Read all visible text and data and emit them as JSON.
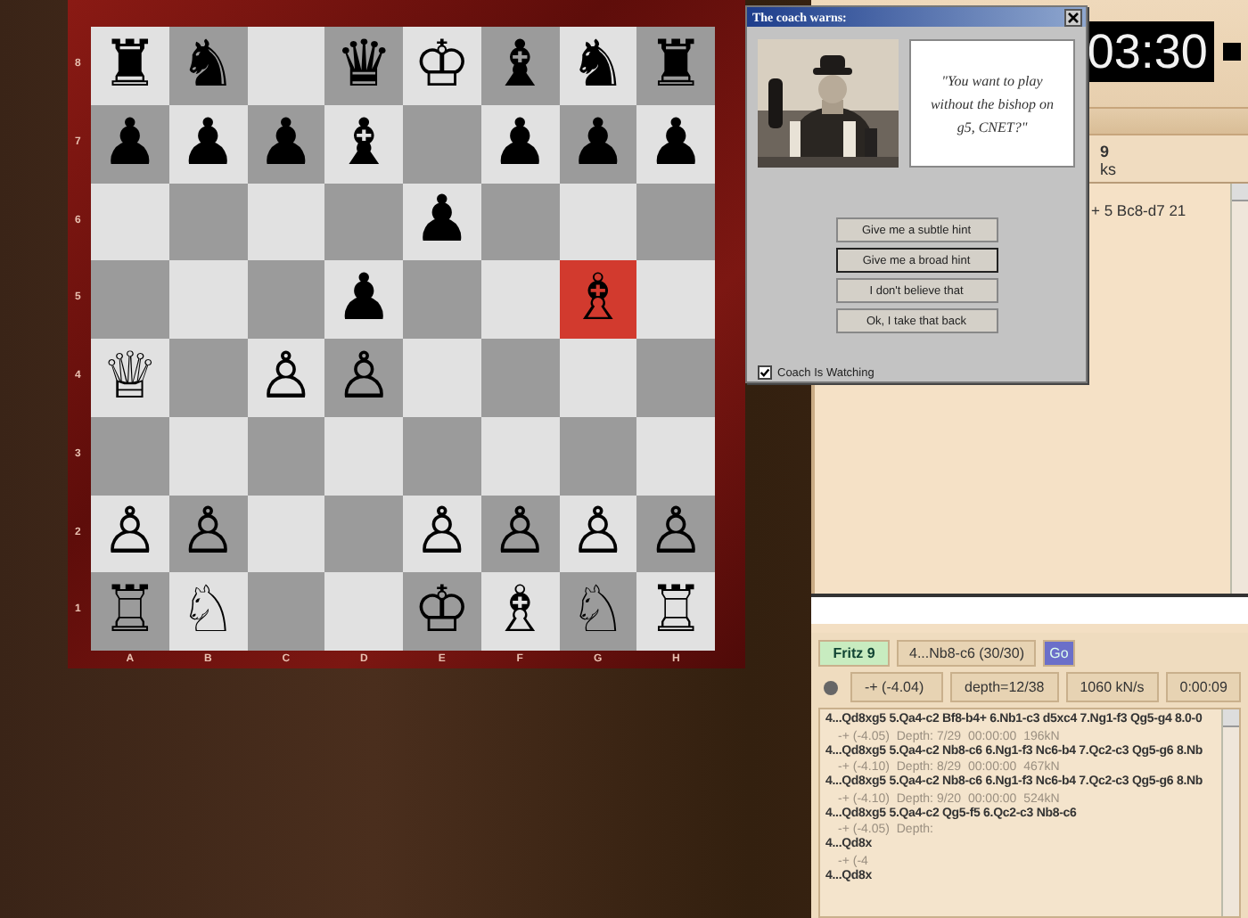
{
  "board": {
    "ranks": [
      {
        "label": "8",
        "squares": [
          {
            "piece": "♜",
            "highlighted": false
          },
          {
            "piece": "♞",
            "highlighted": false
          },
          {
            "highlighted": false
          },
          {
            "piece": "♛",
            "highlighted": false
          },
          {
            "piece": "♔",
            "highlighted": false
          },
          {
            "piece": "♝",
            "highlighted": false
          },
          {
            "piece": "♞",
            "highlighted": false
          },
          {
            "piece": "♜",
            "highlighted": false
          }
        ]
      },
      {
        "label": "7",
        "squares": [
          {
            "piece": "♟",
            "highlighted": false
          },
          {
            "piece": "♟",
            "highlighted": false
          },
          {
            "piece": "♟",
            "highlighted": false
          },
          {
            "piece": "♝",
            "highlighted": false
          },
          {
            "highlighted": false
          },
          {
            "piece": "♟",
            "highlighted": false
          },
          {
            "piece": "♟",
            "highlighted": false
          },
          {
            "piece": "♟",
            "highlighted": false
          }
        ]
      },
      {
        "label": "6",
        "squares": [
          {
            "highlighted": false
          },
          {
            "highlighted": false
          },
          {
            "highlighted": false
          },
          {
            "highlighted": false
          },
          {
            "piece": "♟",
            "highlighted": false
          },
          {
            "highlighted": false
          },
          {
            "highlighted": false
          },
          {
            "highlighted": false
          }
        ]
      },
      {
        "label": "5",
        "squares": [
          {
            "highlighted": false
          },
          {
            "highlighted": false
          },
          {
            "highlighted": false
          },
          {
            "piece": "♟",
            "highlighted": false
          },
          {
            "highlighted": false
          },
          {
            "highlighted": false
          },
          {
            "piece": "♗",
            "highlighted": true
          },
          {
            "highlighted": false
          }
        ]
      },
      {
        "label": "4",
        "squares": [
          {
            "piece": "♕",
            "highlighted": false
          },
          {
            "highlighted": false
          },
          {
            "piece": "♙",
            "highlighted": false
          },
          {
            "piece": "♙",
            "highlighted": false
          },
          {
            "highlighted": false
          },
          {
            "highlighted": false
          },
          {
            "highlighted": false
          },
          {
            "highlighted": false
          }
        ]
      },
      {
        "label": "3",
        "squares": [
          {
            "highlighted": false
          },
          {
            "highlighted": false
          },
          {
            "highlighted": false
          },
          {
            "highlighted": false
          },
          {
            "highlighted": false
          },
          {
            "highlighted": false
          },
          {
            "highlighted": false
          },
          {
            "highlighted": false
          }
        ]
      },
      {
        "label": "2",
        "squares": [
          {
            "piece": "♙",
            "highlighted": false
          },
          {
            "piece": "♙",
            "highlighted": false
          },
          {
            "highlighted": false
          },
          {
            "highlighted": false
          },
          {
            "piece": "♙",
            "highlighted": false
          },
          {
            "piece": "♙",
            "highlighted": false
          },
          {
            "piece": "♙",
            "highlighted": false
          },
          {
            "piece": "♙",
            "highlighted": false
          }
        ]
      },
      {
        "label": "1",
        "squares": [
          {
            "piece": "♖",
            "highlighted": false
          },
          {
            "piece": "♘",
            "highlighted": false
          },
          {
            "highlighted": false
          },
          {
            "highlighted": false
          },
          {
            "piece": "♔",
            "highlighted": false
          },
          {
            "piece": "♗",
            "highlighted": false
          },
          {
            "piece": "♘",
            "highlighted": false
          },
          {
            "piece": "♖",
            "highlighted": false
          }
        ]
      }
    ],
    "files": [
      "A",
      "B",
      "C",
      "D",
      "E",
      "F",
      "G",
      "H"
    ]
  },
  "dialog": {
    "title": "The coach warns:",
    "quote": "\"You want to play without the bishop on g5, CNET?\"",
    "buttons": [
      {
        "label": "Give me a subtle hint",
        "focused": false
      },
      {
        "label": "Give me a broad hint",
        "focused": true
      },
      {
        "label": "I don't believe that",
        "focused": false
      },
      {
        "label": "Ok, I take that back",
        "focused": false
      }
    ],
    "checkbox": {
      "label": "Coach Is Watching",
      "checked": true
    }
  },
  "clock": {
    "time": "03:30"
  },
  "game_panel": {
    "heading_1": "9",
    "heading_2": "ks",
    "moves": "+ 5 Bc8-d7 21"
  },
  "engine": {
    "name": "Fritz 9",
    "move": "4...Nb8-c6 (30/30)",
    "go": "Go",
    "eval": "-+ (-4.04)",
    "depth": "depth=12/38",
    "speed": "1060 kN/s",
    "time": "0:00:09",
    "lines": [
      {
        "moves": "4...Qd8xg5 5.Qa4-c2 Bf8-b4+ 6.Nb1-c3 d5xc4 7.Ng1-f3 Qg5-g4 8.0-0",
        "info": "-+ (-4.05)  Depth: 7/29  00:00:00  196kN"
      },
      {
        "moves": "4...Qd8xg5 5.Qa4-c2 Nb8-c6 6.Ng1-f3 Nc6-b4 7.Qc2-c3 Qg5-g6 8.Nb",
        "info": "-+ (-4.10)  Depth: 8/29  00:00:00  467kN"
      },
      {
        "moves": "4...Qd8xg5 5.Qa4-c2 Nb8-c6 6.Ng1-f3 Nc6-b4 7.Qc2-c3 Qg5-g6 8.Nb",
        "info": "-+ (-4.10)  Depth: 9/20  00:00:00  524kN"
      },
      {
        "moves": "4...Qd8xg5 5.Qa4-c2 Qg5-f5 6.Qc2-c3 Nb8-c6",
        "info": "-+ (-4.05)  Depth:"
      },
      {
        "moves": "4...Qd8x",
        "info": "-+ (-4"
      },
      {
        "moves": "4...Qd8x"
      }
    ]
  }
}
